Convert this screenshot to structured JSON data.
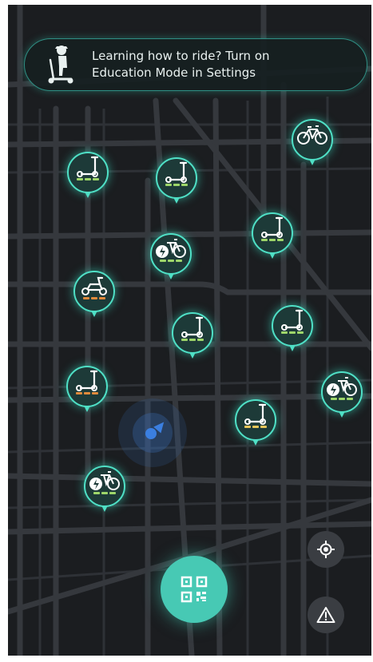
{
  "banner": {
    "text": "Learning how to ride? Turn on Education Mode in Settings",
    "icon": "scooter-rider-icon"
  },
  "colors": {
    "accent": "#4fe0c6",
    "pin_fill": "#1d3a38",
    "map_bg": "#1b1d20",
    "road": "#35383d",
    "battery_green": "#9ed66a",
    "battery_yellow": "#e6c55a",
    "battery_orange": "#e08a3c",
    "user_location": "#3b7fe0",
    "scan_button": "#47c9b4",
    "control_button": "#3a3d42"
  },
  "vehicles": [
    {
      "type": "bike",
      "icon": "bike-icon",
      "battery": null
    },
    {
      "type": "scooter",
      "icon": "scooter-icon",
      "battery": "green"
    },
    {
      "type": "scooter",
      "icon": "scooter-icon",
      "battery": "green"
    },
    {
      "type": "scooter",
      "icon": "scooter-icon",
      "battery": "green"
    },
    {
      "type": "ebike",
      "icon": "ebike-icon",
      "battery": "green"
    },
    {
      "type": "moped",
      "icon": "moped-icon",
      "battery": "orange"
    },
    {
      "type": "scooter",
      "icon": "scooter-icon",
      "battery": "green"
    },
    {
      "type": "scooter",
      "icon": "scooter-icon",
      "battery": "green"
    },
    {
      "type": "scooter",
      "icon": "scooter-icon",
      "battery": "orange"
    },
    {
      "type": "ebike",
      "icon": "ebike-icon",
      "battery": "green"
    },
    {
      "type": "scooter",
      "icon": "scooter-icon",
      "battery": "yellow"
    },
    {
      "type": "ebike",
      "icon": "ebike-icon",
      "battery": "green"
    }
  ],
  "controls": {
    "scan": "qr-code-icon",
    "locate": "locate-icon",
    "report": "warning-icon"
  }
}
